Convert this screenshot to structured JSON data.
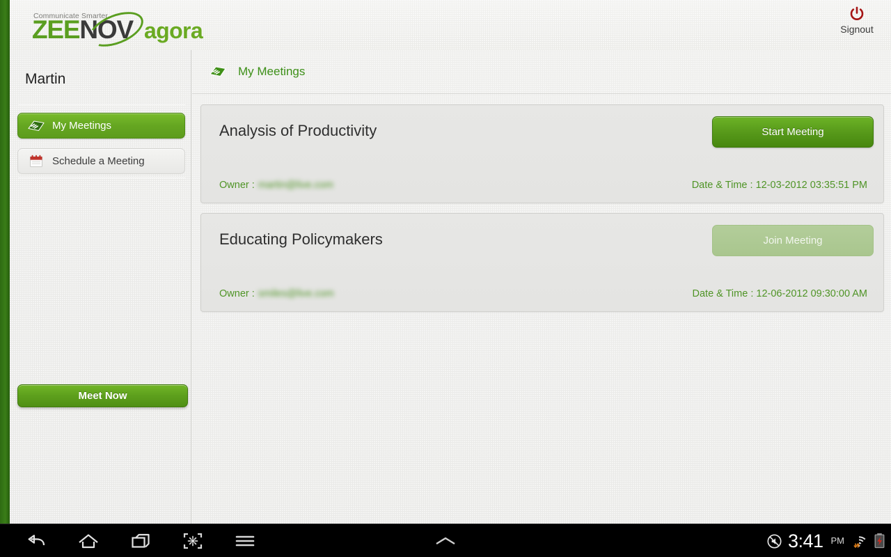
{
  "header": {
    "tagline": "Communicate Smarter",
    "logo_zee": "ZEE",
    "logo_nov": "NOV",
    "logo_agora": "agora",
    "signout_label": "Signout",
    "signout_icon": "power-icon",
    "brand_green": "#5a9e20",
    "signout_red": "#a51414"
  },
  "sidebar": {
    "user_name": "Martin",
    "items": [
      {
        "label": "My Meetings",
        "icon": "meetings-book-icon",
        "active": true
      },
      {
        "label": "Schedule a Meeting",
        "icon": "calendar-icon",
        "active": false
      }
    ],
    "meet_now_label": "Meet Now"
  },
  "main": {
    "title": "My Meetings",
    "title_icon": "meetings-book-icon",
    "owner_label": "Owner :",
    "date_label": "Date & Time :",
    "meetings": [
      {
        "title": "Analysis of Productivity",
        "owner_label": "Owner :",
        "owner_value": "martin@live.com",
        "date_time": "Date & Time : 12-03-2012  03:35:51 PM",
        "action_label": "Start Meeting",
        "action_enabled": true
      },
      {
        "title": "Educating Policymakers",
        "owner_label": "Owner :",
        "owner_value": "smiles@live.com",
        "date_time": "Date & Time : 12-06-2012  09:30:00 AM",
        "action_label": "Join Meeting",
        "action_enabled": false
      }
    ]
  },
  "system_bar": {
    "buttons": [
      {
        "name": "back-icon"
      },
      {
        "name": "home-icon"
      },
      {
        "name": "recents-icon"
      },
      {
        "name": "screenshot-icon"
      },
      {
        "name": "menu-icon"
      }
    ],
    "drawer_icon": "chevron-up-icon",
    "mute_icon": "mute-icon",
    "wifi_icon": "wifi-icon",
    "battery_icon": "battery-error-icon",
    "clock": "3:41",
    "am_pm": "PM"
  }
}
